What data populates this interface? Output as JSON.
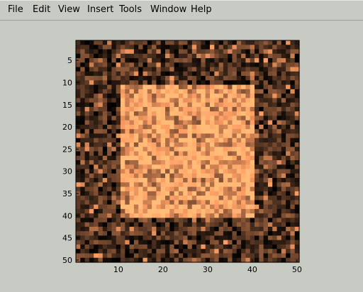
{
  "menu": {
    "items": [
      {
        "label": "File"
      },
      {
        "label": "Edit"
      },
      {
        "label": "View"
      },
      {
        "label": "Insert"
      },
      {
        "label": "Tools"
      },
      {
        "label": "Window"
      },
      {
        "label": "Help"
      }
    ]
  },
  "chart_data": {
    "type": "heatmap",
    "title": "",
    "xlabel": "",
    "ylabel": "",
    "colormap": "copper",
    "grid": false,
    "size": [
      50,
      50
    ],
    "xlim": [
      0.5,
      50.5
    ],
    "ylim": [
      0.5,
      50.5
    ],
    "y_direction": "reverse",
    "xticks": [
      10,
      20,
      30,
      40,
      50
    ],
    "yticks": [
      5,
      10,
      15,
      20,
      25,
      30,
      35,
      40,
      45,
      50
    ],
    "description_of_values": {
      "inner_square_rows": [
        11,
        40
      ],
      "inner_square_cols": [
        11,
        40
      ],
      "inner_level": 0.95,
      "outer_level": 0.2
    },
    "colors": {
      "axes_bg": "#000000",
      "copper_low": "#000000",
      "copper_high": "#ffc77f"
    }
  }
}
